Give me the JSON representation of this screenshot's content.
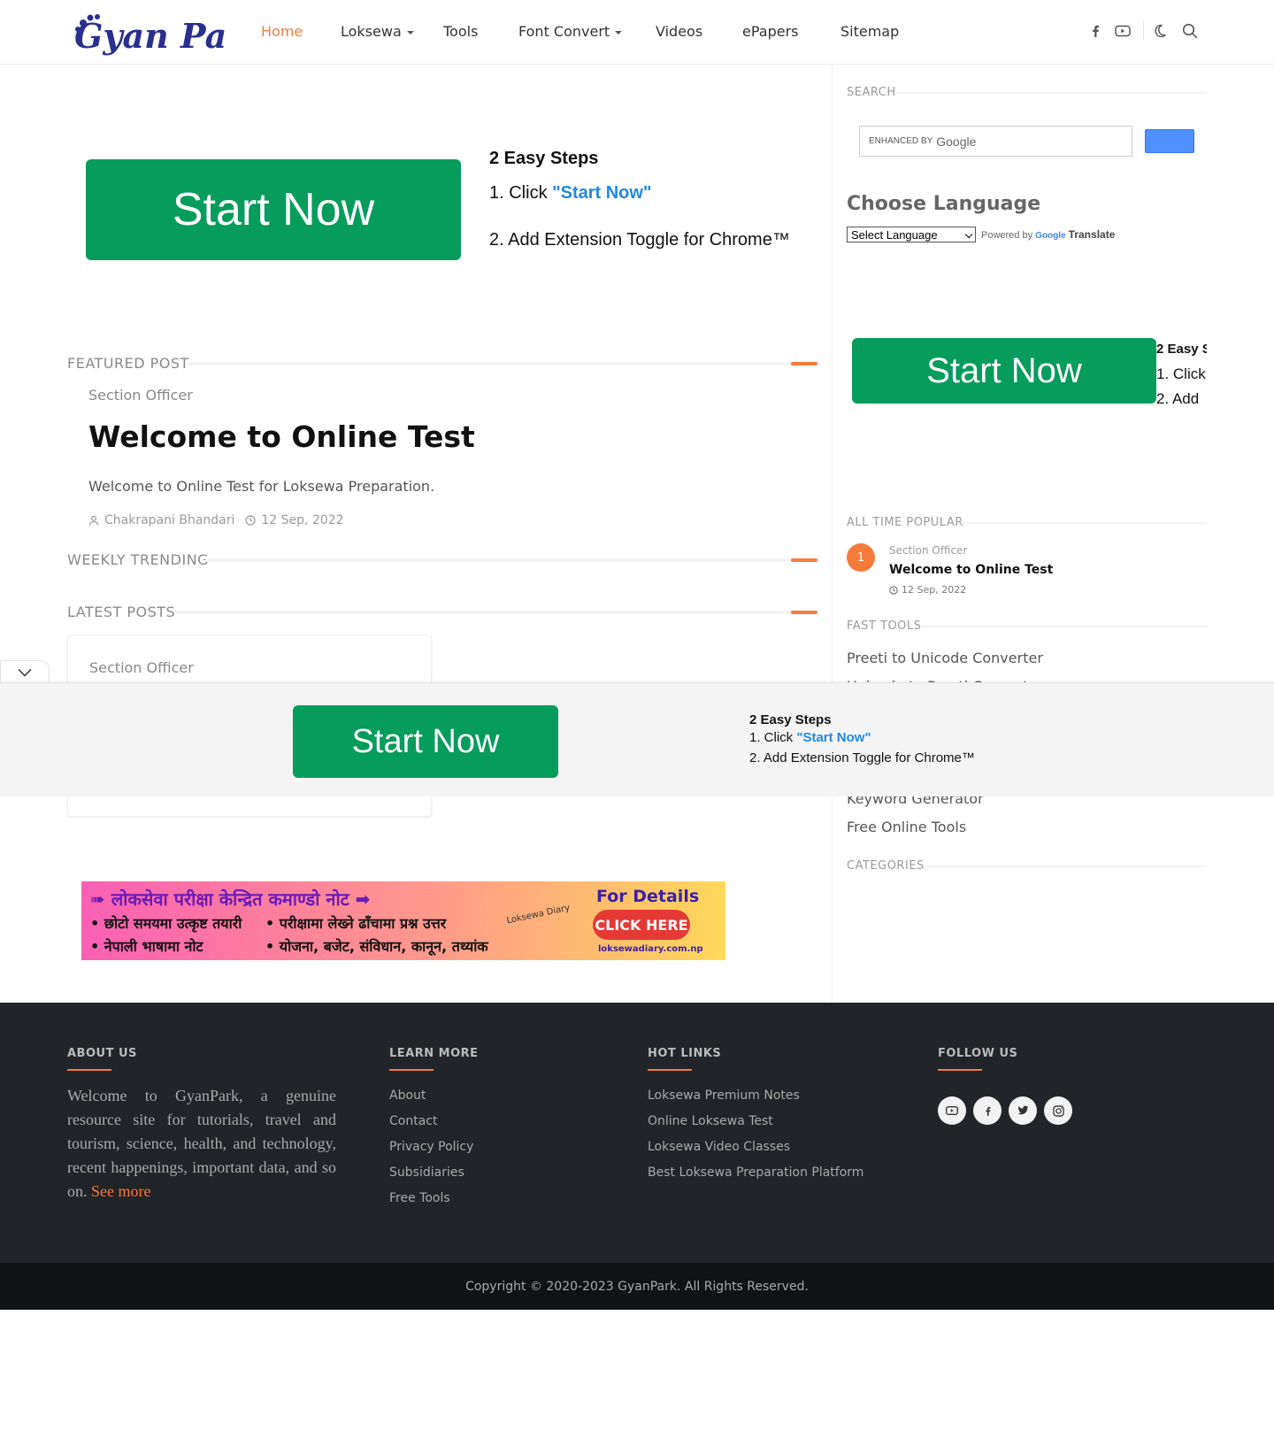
{
  "brand": {
    "name": "Gyan Park",
    "accent": "#f57b3c",
    "ad_green": "#059c5c",
    "link_blue": "#1e88e5"
  },
  "nav": {
    "items": [
      {
        "label": "Home",
        "active": true,
        "dropdown": false
      },
      {
        "label": "Loksewa",
        "active": false,
        "dropdown": true
      },
      {
        "label": "Tools",
        "active": false,
        "dropdown": false
      },
      {
        "label": "Font Convert",
        "active": false,
        "dropdown": true
      },
      {
        "label": "Videos",
        "active": false,
        "dropdown": false
      },
      {
        "label": "ePapers",
        "active": false,
        "dropdown": false
      },
      {
        "label": "Sitemap",
        "active": false,
        "dropdown": false
      }
    ],
    "icons": [
      "facebook-icon",
      "youtube-icon",
      "dark-mode-icon",
      "search-icon"
    ]
  },
  "ad_main": {
    "button": "Start Now",
    "steps_title": "2 Easy Steps",
    "step1_prefix": "1. Click ",
    "step1_link": "\"Start Now\"",
    "step2": "2. Add Extension Toggle for Chrome™"
  },
  "featured": {
    "section_title": "FEATURED POST",
    "label": "Section Officer",
    "title": "Welcome to Online Test",
    "desc": "Welcome to Online Test for Loksewa Preparation.",
    "author": "Chakrapani Bhandari",
    "date": "12 Sep, 2022"
  },
  "weekly": {
    "section_title": "WEEKLY TRENDING"
  },
  "latest": {
    "section_title": "LATEST POSTS",
    "card_label": "Section Officer"
  },
  "banner": {
    "headline": "➠ लोकसेवा परीक्षा केन्द्रित कमाण्डो नोट ➡",
    "row1a": "• छोटो समयमा उत्कृष्ट तयारी",
    "row1b": "• परीक्षामा लेख्ने ढाँचामा प्रश्न उत्तर",
    "row2a": "• नेपाली भाषामा नोट",
    "row2b": "• योजना, बजेट, संविधान, कानून, तथ्यांक",
    "details": "For Details",
    "button": "CLICK HERE",
    "url": "loksewadiary.com.np",
    "brand": "Loksewa Diary"
  },
  "sidebar": {
    "search_title": "SEARCH",
    "search_placeholder_prefix": "ENHANCED BY",
    "search_placeholder_brand": "Google",
    "lang_title": "Choose Language",
    "lang_select": "Select Language",
    "powered_prefix": "Powered by",
    "powered_google": "Google",
    "powered_translate": "Translate",
    "ad_button": "Start Now",
    "ad_steps_title": "2 Easy S",
    "ad_step1": "1. Click",
    "ad_step2": "2. Add",
    "popular_title": "ALL TIME POPULAR",
    "popular": {
      "rank": "1",
      "label": "Section Officer",
      "title": "Welcome to Online Test",
      "date": "12 Sep, 2022"
    },
    "tools_title": "FAST TOOLS",
    "tools": [
      "Preeti to Unicode Converter",
      "Unicode to Preeti Converter",
      "Keyword Generator",
      "Free Online Tools"
    ],
    "categories_title": "CATEGORIES"
  },
  "sticky_ad": {
    "button": "Start Now",
    "steps_title": "2 Easy Steps",
    "step1_prefix": "1. Click ",
    "step1_link": "\"Start Now\"",
    "step2": "2. Add Extension Toggle for Chrome™"
  },
  "footer": {
    "about_title": "ABOUT US",
    "about_text": "Welcome to GyanPark, a genuine resource site for tutorials, travel and tourism, science, health, and technology, recent happenings, important data, and so on.",
    "about_more": "See more",
    "learn_title": "LEARN MORE",
    "learn_links": [
      "About",
      "Contact",
      "Privacy Policy",
      "Subsidiaries",
      "Free Tools"
    ],
    "hot_title": "HOT LINKS",
    "hot_links": [
      "Loksewa Premium Notes",
      "Online Loksewa Test",
      "Loksewa Video Classes",
      "Best Loksewa Preparation Platform"
    ],
    "follow_title": "FOLLOW US",
    "social": [
      "youtube-icon",
      "facebook-icon",
      "twitter-icon",
      "instagram-icon"
    ],
    "copyright": "Copyright © 2020-2023 GyanPark. All Rights Reserved."
  }
}
